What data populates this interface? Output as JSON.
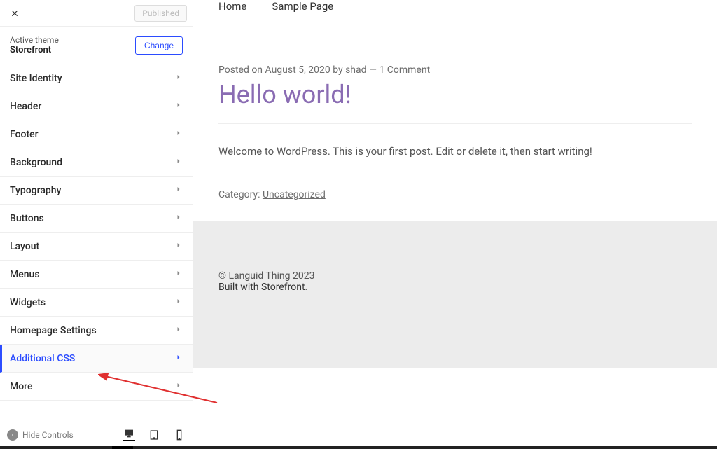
{
  "sidebar": {
    "published_label": "Published",
    "active_theme_label": "Active theme",
    "theme_name": "Storefront",
    "change_label": "Change",
    "items": [
      {
        "label": "Site Identity",
        "active": false
      },
      {
        "label": "Header",
        "active": false
      },
      {
        "label": "Footer",
        "active": false
      },
      {
        "label": "Background",
        "active": false
      },
      {
        "label": "Typography",
        "active": false
      },
      {
        "label": "Buttons",
        "active": false
      },
      {
        "label": "Layout",
        "active": false
      },
      {
        "label": "Menus",
        "active": false
      },
      {
        "label": "Widgets",
        "active": false
      },
      {
        "label": "Homepage Settings",
        "active": false
      },
      {
        "label": "Additional CSS",
        "active": true
      },
      {
        "label": "More",
        "active": false
      }
    ],
    "hide_controls_label": "Hide Controls"
  },
  "preview": {
    "nav": [
      "Home",
      "Sample Page"
    ],
    "post": {
      "posted_on_label": "Posted on ",
      "date": "August 5, 2020",
      "by_label": " by ",
      "author": "shad",
      "dash": " — ",
      "comments": "1 Comment",
      "title": "Hello world!",
      "body": "Welcome to WordPress. This is your first post. Edit or delete it, then start writing!",
      "category_label": "Category: ",
      "category": "Uncategorized"
    },
    "footer": {
      "copyright": "© Languid Thing 2023",
      "built_with": "Built with Storefront",
      "dot": "."
    }
  }
}
